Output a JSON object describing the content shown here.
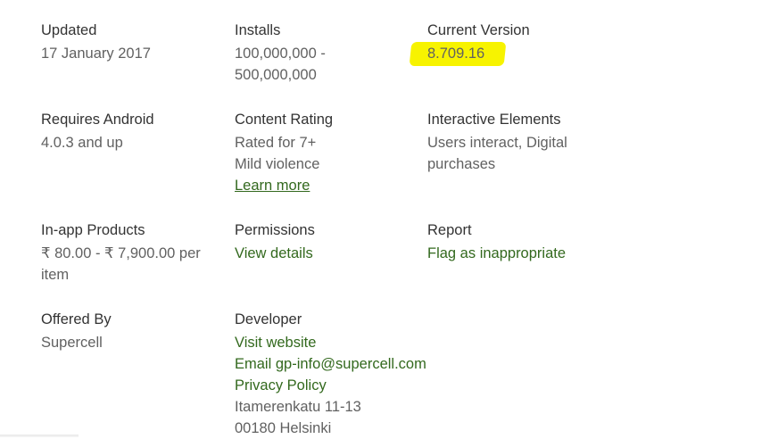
{
  "details": {
    "updated": {
      "title": "Updated",
      "value": "17 January 2017"
    },
    "installs": {
      "title": "Installs",
      "value_line1": "100,000,000 -",
      "value_line2": "500,000,000"
    },
    "current_version": {
      "title": "Current Version",
      "value": "8.709.16"
    },
    "requires_android": {
      "title": "Requires Android",
      "value": "4.0.3 and up"
    },
    "content_rating": {
      "title": "Content Rating",
      "value_line1": "Rated for 7+",
      "value_line2": "Mild violence",
      "link": "Learn more"
    },
    "interactive_elements": {
      "title": "Interactive Elements",
      "value_line1": "Users interact, Digital",
      "value_line2": "purchases"
    },
    "in_app_products": {
      "title": "In-app Products",
      "value_line1": "₹ 80.00 - ₹ 7,900.00 per",
      "value_line2": "item"
    },
    "permissions": {
      "title": "Permissions",
      "link": "View details"
    },
    "report": {
      "title": "Report",
      "link": "Flag as inappropriate"
    },
    "offered_by": {
      "title": "Offered By",
      "value": "Supercell"
    },
    "developer": {
      "title": "Developer",
      "website": "Visit website",
      "email": "Email gp-info@supercell.com",
      "privacy": "Privacy Policy",
      "address_line1": "Itamerenkatu 11-13",
      "address_line2": "00180 Helsinki"
    }
  },
  "colors": {
    "highlight": "#f7f300",
    "link_green": "#33691e",
    "text_gray": "#616161",
    "title_dark": "#333333"
  }
}
